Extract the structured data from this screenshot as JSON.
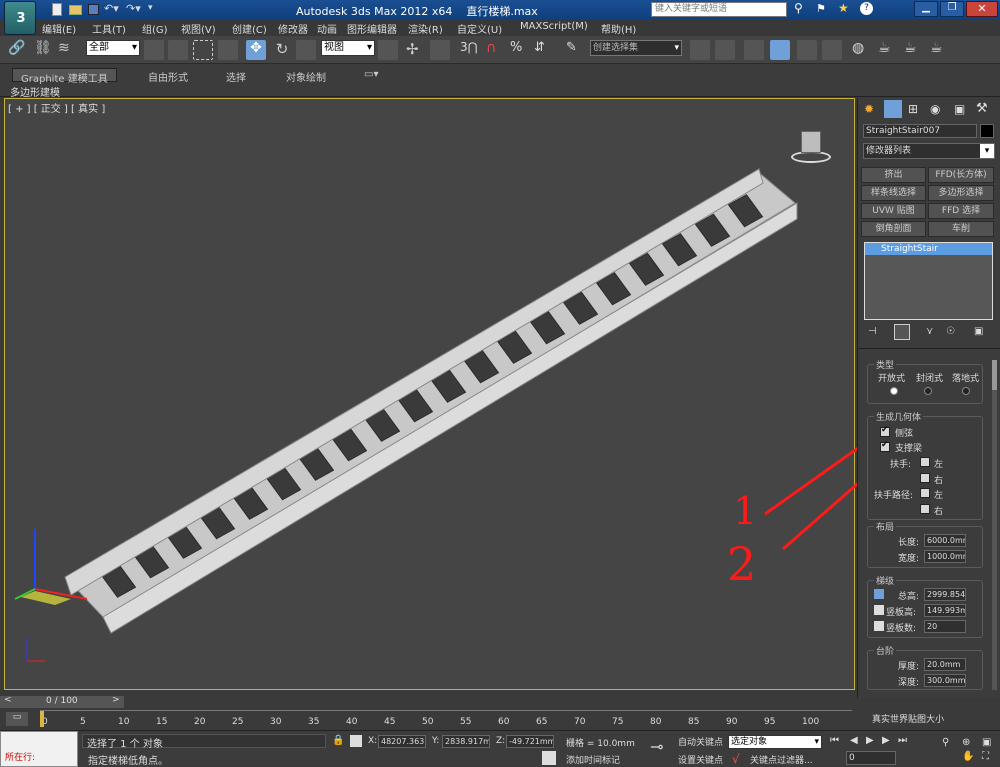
{
  "app": {
    "title": "Autodesk 3ds Max  2012 x64",
    "file": "直行楼梯.max",
    "search_placeholder": "键入关键字或短语"
  },
  "menu": [
    "编辑(E)",
    "工具(T)",
    "组(G)",
    "视图(V)",
    "创建(C)",
    "修改器",
    "动画",
    "图形编辑器",
    "渲染(R)",
    "自定义(U)",
    "MAXScript(M)",
    "帮助(H)"
  ],
  "toolbar": {
    "selection_filter": "全部",
    "ref_coord": "视图",
    "named_selection": "创建选择集",
    "snap_angle": "3",
    "percent": "%"
  },
  "ribbon": {
    "tabs": [
      "Graphite 建模工具",
      "自由形式",
      "选择",
      "对象绘制"
    ],
    "subtab": "多边形建模"
  },
  "viewport": {
    "label": "[ + ] [ 正交 ] [ 真实 ]"
  },
  "panel": {
    "object_name": "StraightStair007",
    "modifier_list": "修改器列表",
    "buttons": [
      "挤出",
      "FFD(长方体)",
      "样条线选择",
      "多边形选择",
      "UVW 贴图",
      "FFD 选择",
      "倒角剖面",
      "车削"
    ],
    "stack_item": "StraightStair",
    "type_group": {
      "title": "类型",
      "options": [
        "开放式",
        "封闭式",
        "落地式"
      ]
    },
    "geometry_group": {
      "title": "生成几何体",
      "side_string": "侧弦",
      "support_beam": "支撑梁",
      "handrail": "扶手:",
      "handrail_path": "扶手路径:",
      "left": "左",
      "right": "右"
    },
    "layout_group": {
      "title": "布局",
      "length_label": "长度:",
      "length": "6000.0mm",
      "width_label": "宽度:",
      "width": "1000.0mm"
    },
    "steps_group": {
      "title": "梯级",
      "overall_label": "总高:",
      "overall": "2999.854",
      "riser_ht_label": "竖板高:",
      "riser_ht": "149.993m",
      "riser_count_label": "竖板数:",
      "riser_count": "20"
    },
    "step_group": {
      "title": "台阶",
      "thickness_label": "厚度:",
      "thickness": "20.0mm",
      "depth_label": "深度:",
      "depth": "300.0mm"
    },
    "real_world": "真实世界贴图大小"
  },
  "timeline": {
    "frame": "0 / 100",
    "ticks": [
      "0",
      "5",
      "10",
      "15",
      "20",
      "25",
      "30",
      "35",
      "40",
      "45",
      "50",
      "55",
      "60",
      "65",
      "70",
      "75",
      "80",
      "85",
      "90",
      "95",
      "100"
    ]
  },
  "status": {
    "script_label": "所在行:",
    "selected": "选择了 1 个 对象",
    "prompt": "指定楼梯低角点。",
    "x_label": "X:",
    "x": "48207.363",
    "y_label": "Y:",
    "y": "2838.917m",
    "z_label": "Z:",
    "z": "-49.721mm",
    "grid": "栅格 = 10.0mm",
    "auto_key": "自动关键点",
    "set_key": "设置关键点",
    "selected_obj": "选定对象",
    "key_filter": "关键点过滤器...",
    "add_time_tag": "添加时间标记",
    "frame": "0"
  },
  "annotations": [
    "1",
    "2"
  ]
}
